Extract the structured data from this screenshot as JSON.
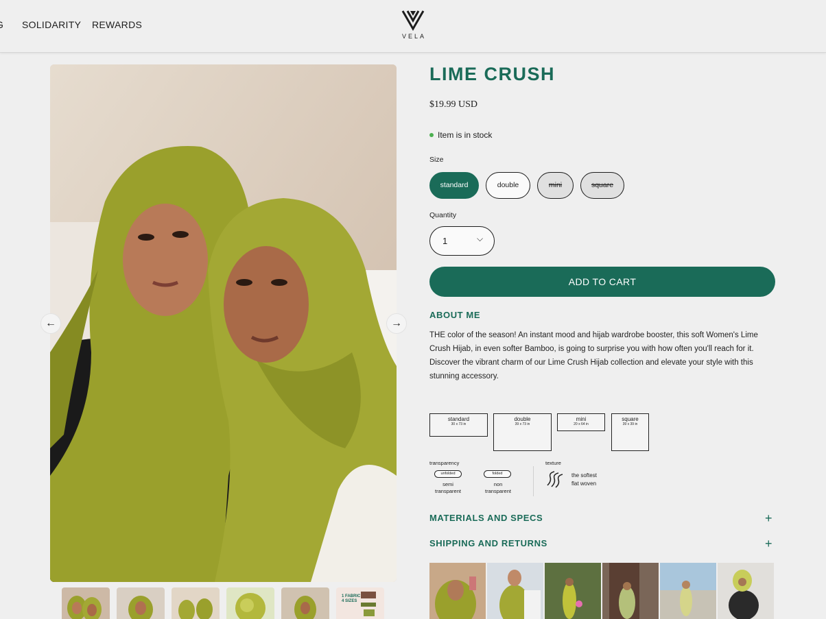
{
  "header": {
    "nav": [
      "G",
      "SOLIDARITY",
      "REWARDS"
    ],
    "logo_text": "VELA"
  },
  "gallery": {
    "prev_label": "←",
    "next_label": "→",
    "thumb_label": "1 FABRIC\n4 SIZES"
  },
  "product": {
    "title": "LIME CRUSH",
    "price": "$19.99 USD",
    "stock": "Item is in stock",
    "size_label": "Size",
    "sizes": [
      {
        "label": "standard",
        "state": "selected"
      },
      {
        "label": "double",
        "state": "available"
      },
      {
        "label": "mini",
        "state": "unavailable"
      },
      {
        "label": "square",
        "state": "unavailable"
      }
    ],
    "quantity_label": "Quantity",
    "quantity_value": "1",
    "add_to_cart": "ADD TO CART"
  },
  "about": {
    "heading": "ABOUT ME",
    "text": "THE color of the season! An instant mood and hijab wardrobe booster, this soft Women's Lime Crush Hijab, in even softer Bamboo, is going to surprise you with how often you'll reach for it. Discover the vibrant charm of our Lime Crush Hijab collection and elevate your style with this stunning accessory."
  },
  "size_guide": [
    {
      "name": "standard",
      "dims": "30 x 73 in"
    },
    {
      "name": "double",
      "dims": "39 x 73 in"
    },
    {
      "name": "mini",
      "dims": "20 x 64 in"
    },
    {
      "name": "square",
      "dims": "39 x 39 in"
    }
  ],
  "attributes": {
    "transparency_label": "transparency",
    "unfolded": "unfolded",
    "folded": "folded",
    "semi": "semi\ntransparent",
    "non": "non\ntransparent",
    "texture_label": "texture",
    "texture_value": "the softest\nflat woven"
  },
  "accordions": [
    {
      "title": "MATERIALS AND SPECS",
      "icon": "plus-icon"
    },
    {
      "title": "SHIPPING AND RETURNS",
      "icon": "plus-icon"
    }
  ],
  "colors": {
    "brand": "#1a6b58",
    "background": "#efefef",
    "stock_dot": "#4caf50",
    "hijab": "#9aa02c"
  }
}
